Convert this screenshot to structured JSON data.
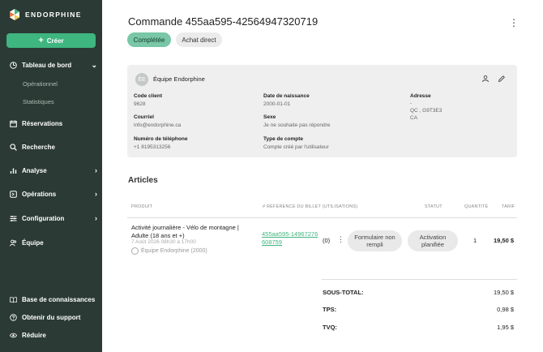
{
  "brand": {
    "name": "ENDORPHINE",
    "accent": "#3fb57f",
    "sidebar_bg": "#2b3a34"
  },
  "sidebar": {
    "create_label": "Créer",
    "items": [
      {
        "label": "Tableau de bord",
        "icon": "dashboard-icon",
        "expanded": true
      },
      {
        "label": "Opérationnel"
      },
      {
        "label": "Statistiques"
      },
      {
        "label": "Réservations",
        "icon": "calendar-icon"
      },
      {
        "label": "Recherche",
        "icon": "search-icon"
      },
      {
        "label": "Analyse",
        "icon": "chart-icon"
      },
      {
        "label": "Opérations",
        "icon": "operations-icon"
      },
      {
        "label": "Configuration",
        "icon": "sliders-icon"
      },
      {
        "label": "Équipe",
        "icon": "team-icon"
      }
    ],
    "footer": [
      {
        "label": "Base de connaissances",
        "icon": "book-icon"
      },
      {
        "label": "Obtenir du support",
        "icon": "help-icon"
      },
      {
        "label": "Réduire",
        "icon": "eye-icon"
      }
    ]
  },
  "order": {
    "title": "Commande 455aa595-42564947320719",
    "status": "Complétée",
    "type": "Achat direct"
  },
  "customer": {
    "avatar_initials": "ÉE",
    "name": "Équipe Endorphine",
    "code_label": "Code client",
    "code_value": "9628",
    "email_label": "Courriel",
    "email_value": "info@endorphine.ca",
    "phone_label": "Numéro de téléphone",
    "phone_value": "+1 8195313256",
    "dob_label": "Date de naissance",
    "dob_value": "2000-01-01",
    "sex_label": "Sexe",
    "sex_value": "Je ne souhaite pas répondre",
    "account_label": "Type de compte",
    "account_value": "Compte créé par l'utilisateur",
    "address_label": "Adresse",
    "address_line1": "-",
    "address_line2": "QC , G9T3E3",
    "address_line3": "CA"
  },
  "articles": {
    "title": "Articles",
    "headers": {
      "product": "PRODUIT",
      "ticket": "# RÉFÉRENCE DU BILLET (UTILISATIONS)",
      "status": "STATUT",
      "quantity": "QUANTITÉ",
      "price": "TARIF"
    },
    "rows": [
      {
        "name": "Activité journalière - Vélo de montagne | Adulte (18 ans et +)",
        "date": "7 Août 2026 08h30 à 17h00",
        "organizer": "Équipe Endorphine (2000)",
        "ticket_ref": "455aa595-14967276608759",
        "usage": "(0)",
        "form_status": "Formulaire non rempli",
        "activation_status": "Activation planifiée",
        "quantity": "1",
        "price": "19,50 $"
      }
    ]
  },
  "totals": {
    "subtotal_label": "SOUS-TOTAL:",
    "subtotal_value": "19,50 $",
    "tps_label": "TPS:",
    "tps_value": "0,98 $",
    "tvq_label": "TVQ:",
    "tvq_value": "1,95 $"
  }
}
